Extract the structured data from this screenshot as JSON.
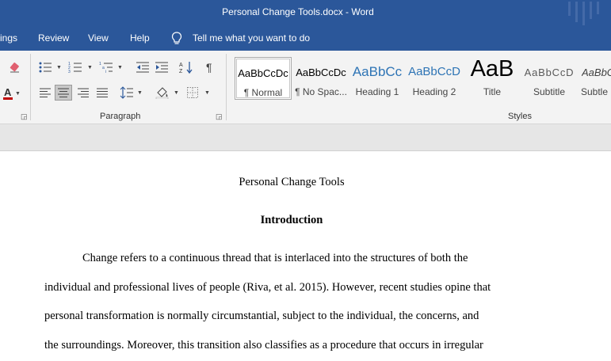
{
  "window": {
    "title": "Personal Change Tools.docx  -  Word"
  },
  "menu": {
    "items": [
      "ings",
      "Review",
      "View",
      "Help"
    ],
    "tell_me": "Tell me what you want to do"
  },
  "ribbon": {
    "paragraph_group_label": "Paragraph",
    "styles_group_label": "Styles",
    "styles": [
      {
        "preview": "AaBbCcDc",
        "label": "¶ Normal"
      },
      {
        "preview": "AaBbCcDc",
        "label": "¶ No Spac..."
      },
      {
        "preview": "AaBbCc",
        "label": "Heading 1"
      },
      {
        "preview": "AaBbCcD",
        "label": "Heading 2"
      },
      {
        "preview": "AaB",
        "label": "Title"
      },
      {
        "preview": "AaBbCcD",
        "label": "Subtitle"
      },
      {
        "preview": "AaBbC",
        "label": "Subtle E"
      }
    ],
    "colors": {
      "heading_blue": "#2e74b5",
      "font_color_red": "#c00000"
    }
  },
  "document": {
    "title": "Personal Change Tools",
    "heading": "Introduction",
    "lines": [
      "Change refers to a continuous thread that is interlaced into the structures of both the",
      "individual and professional lives of people (Riva, et al. 2015). However, recent studies opine that",
      "personal transformation is normally circumstantial, subject to the individual, the concerns, and",
      "the surroundings. Moreover, this transition also classifies as a procedure that occurs in irregular"
    ]
  }
}
